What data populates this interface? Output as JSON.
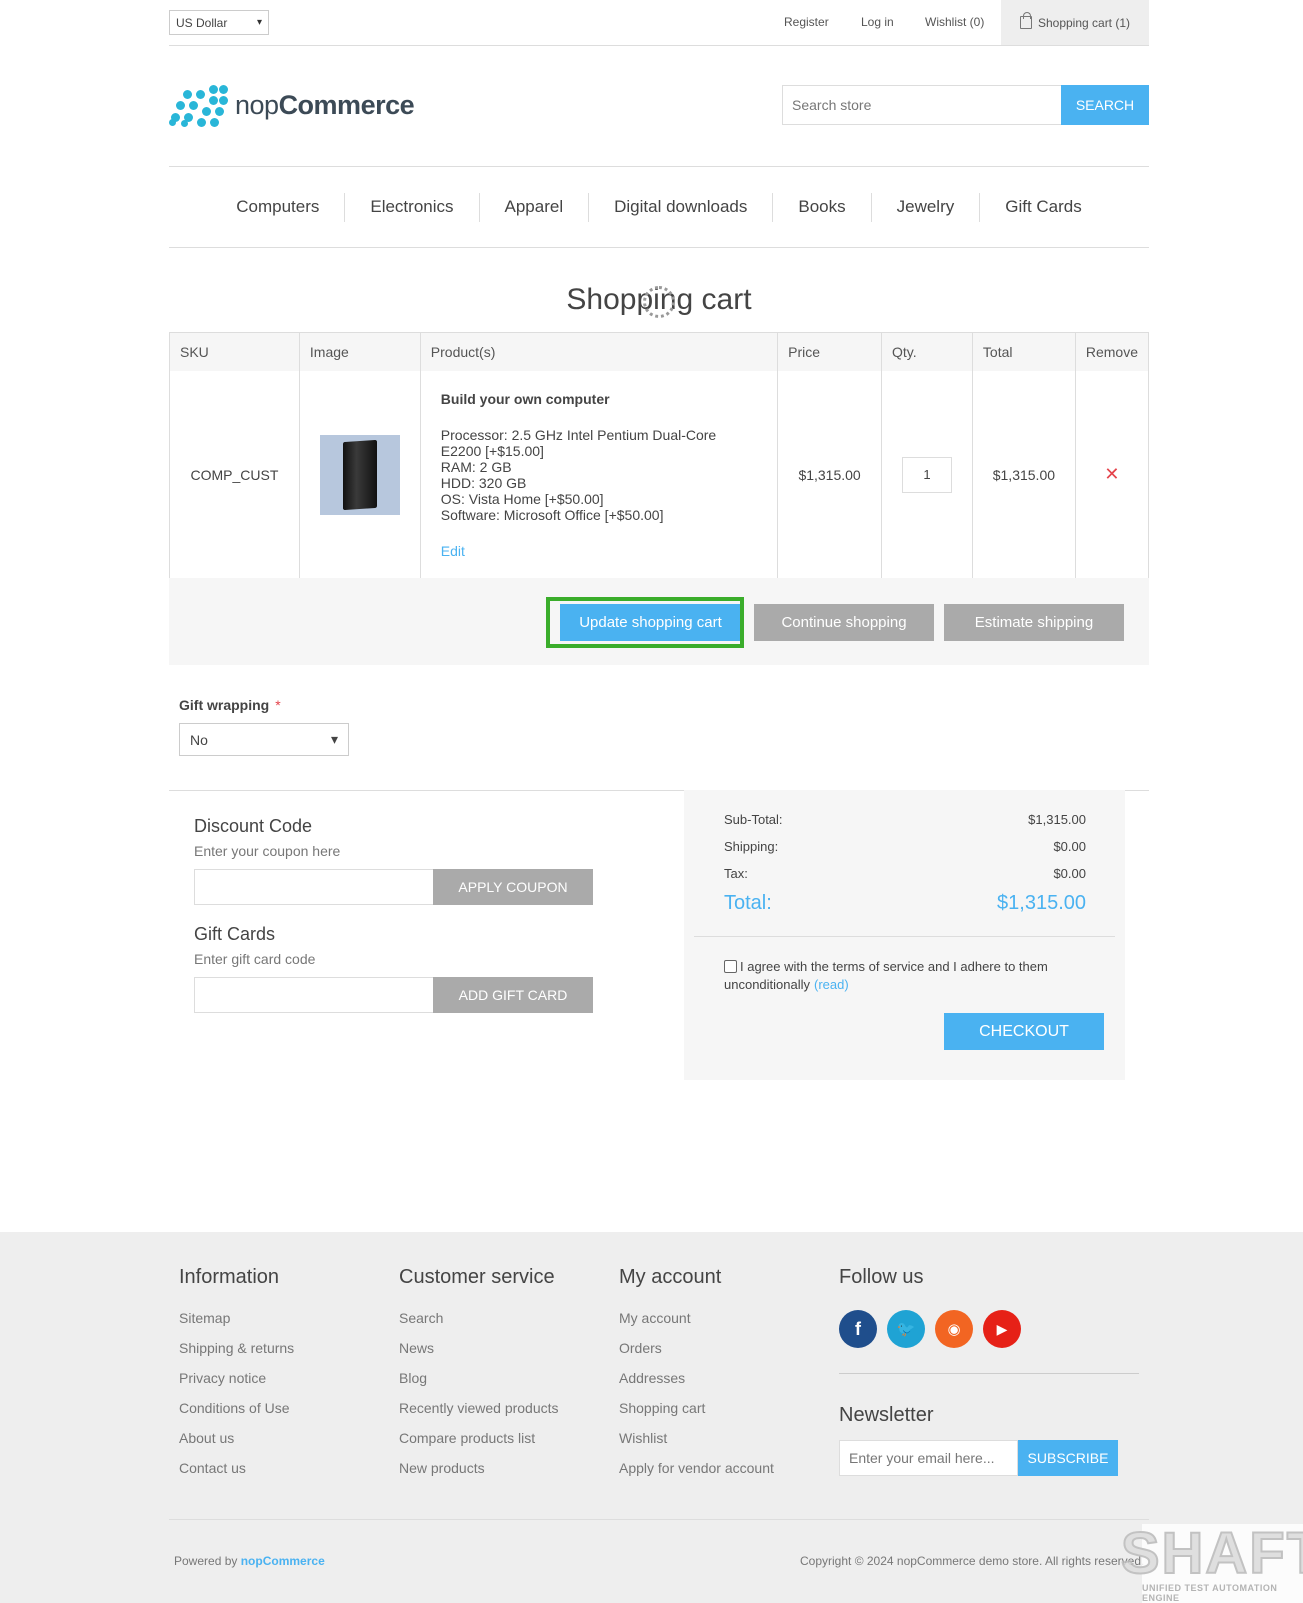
{
  "header": {
    "currency": "US Dollar",
    "links": [
      "Register",
      "Log in",
      "Wishlist (0)"
    ],
    "cart_link": "Shopping cart (1)"
  },
  "logo": {
    "text_light": "nop",
    "text_bold": "Commerce"
  },
  "search": {
    "placeholder": "Search store",
    "button": "SEARCH"
  },
  "menu": [
    "Computers",
    "Electronics",
    "Apparel",
    "Digital downloads",
    "Books",
    "Jewelry",
    "Gift Cards"
  ],
  "page_title": "Shopping cart",
  "table": {
    "headers": [
      "SKU",
      "Image",
      "Product(s)",
      "Price",
      "Qty.",
      "Total",
      "Remove"
    ],
    "row": {
      "sku": "COMP_CUST",
      "product_name": "Build your own computer",
      "attributes": "Processor: 2.5 GHz Intel Pentium Dual-Core\nE2200 [+$15.00]\nRAM: 2 GB\nHDD: 320 GB\nOS: Vista Home [+$50.00]\nSoftware: Microsoft Office [+$50.00]",
      "edit": "Edit",
      "price": "$1,315.00",
      "qty": "1",
      "total": "$1,315.00",
      "remove": "✕"
    }
  },
  "buttons": {
    "update": "Update shopping cart",
    "continue": "Continue shopping",
    "estimate": "Estimate shipping"
  },
  "gift_wrapping": {
    "label": "Gift wrapping",
    "required": "*",
    "value": "No"
  },
  "discount": {
    "title": "Discount Code",
    "hint": "Enter your coupon here",
    "button": "APPLY COUPON"
  },
  "gift_cards": {
    "title": "Gift Cards",
    "hint": "Enter gift card code",
    "button": "ADD GIFT CARD"
  },
  "totals": {
    "subtotal_label": "Sub-Total:",
    "subtotal": "$1,315.00",
    "shipping_label": "Shipping:",
    "shipping": "$0.00",
    "tax_label": "Tax:",
    "tax": "$0.00",
    "total_label": "Total:",
    "total": "$1,315.00",
    "terms": "I agree with the terms of service and I adhere to them unconditionally",
    "read": "(read)",
    "checkout": "CHECKOUT"
  },
  "footer": {
    "information": {
      "title": "Information",
      "links": [
        "Sitemap",
        "Shipping & returns",
        "Privacy notice",
        "Conditions of Use",
        "About us",
        "Contact us"
      ]
    },
    "customer_service": {
      "title": "Customer service",
      "links": [
        "Search",
        "News",
        "Blog",
        "Recently viewed products",
        "Compare products list",
        "New products"
      ]
    },
    "my_account": {
      "title": "My account",
      "links": [
        "My account",
        "Orders",
        "Addresses",
        "Shopping cart",
        "Wishlist",
        "Apply for vendor account"
      ]
    },
    "follow": {
      "title": "Follow us"
    },
    "newsletter": {
      "title": "Newsletter",
      "placeholder": "Enter your email here...",
      "button": "SUBSCRIBE"
    },
    "powered_prefix": "Powered by",
    "powered_brand": "nopCommerce",
    "copyright": "Copyright © 2024 nopCommerce demo store. All rights reserved."
  },
  "watermark": {
    "big": "SHAFT",
    "small": "UNIFIED TEST AUTOMATION ENGINE"
  },
  "colors": {
    "accent": "#4ab2f1",
    "highlight": "#3aad2b",
    "remove": "#e4434b",
    "facebook": "#1f4e8c",
    "twitter": "#1fa3d4",
    "rss": "#f26522",
    "youtube": "#e62117"
  }
}
